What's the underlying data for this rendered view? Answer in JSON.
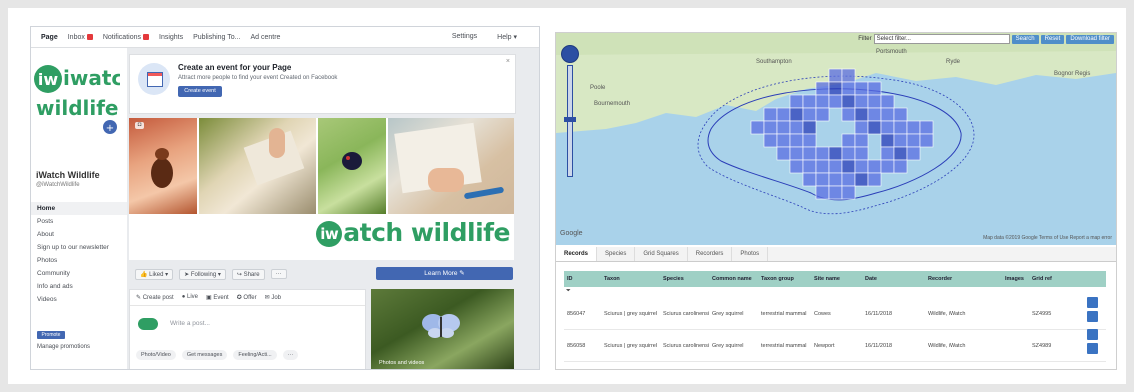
{
  "facebook": {
    "top_tabs": [
      {
        "label": "Page",
        "badge": false,
        "active": true
      },
      {
        "label": "Inbox",
        "badge": true,
        "active": false
      },
      {
        "label": "Notifications",
        "badge": true,
        "active": false
      },
      {
        "label": "Insights",
        "badge": false,
        "active": false
      },
      {
        "label": "Publishing To...",
        "badge": false,
        "active": false
      },
      {
        "label": "Ad centre",
        "badge": false,
        "active": false
      }
    ],
    "settings_label": "Settings",
    "help_label": "Help ▾",
    "logo_top": "iwatch",
    "logo_bottom": "wildlife",
    "page_name": "iWatch Wildlife",
    "page_handle": "@iWatchWildlife",
    "nav": [
      "Home",
      "Posts",
      "About",
      "Sign up to our newsletter",
      "Photos",
      "Community",
      "Info and ads",
      "Videos"
    ],
    "promote_label": "Promote",
    "manage_label": "Manage promotions",
    "event_card": {
      "title": "Create an event for your Page",
      "subtitle": "Attract more people to find your event Created on Facebook",
      "button": "Create event",
      "close": "×"
    },
    "cover_logo_circle": "iw",
    "cover_logo_text": "atch wildlife",
    "actions": [
      "👍 Liked ▾",
      "➤ Following ▾",
      "↪ Share",
      "···"
    ],
    "learn_more": "Learn More ✎",
    "composer_tabs": [
      "✎ Create post",
      "● Live",
      "▣ Event",
      "✪ Offer",
      "✉ Job"
    ],
    "composer_placeholder": "Write a post...",
    "composer_buttons": [
      "Photo/Video",
      "Get messages",
      "Feeling/Acti...",
      "···"
    ],
    "side_caption": "Photos and videos"
  },
  "map_app": {
    "filter_label": "Filter",
    "filter_value": "Select filter...",
    "toolbar_buttons": [
      "Search",
      "Reset",
      "Download filter"
    ],
    "map_places": [
      "Portsmouth",
      "Southampton",
      "Bournemouth",
      "Poole",
      "Ryde",
      "Bognor Regis"
    ],
    "google_label": "Google",
    "map_footer": "Map data ©2019 Google   Terms of Use   Report a map error",
    "tabs": [
      "Records",
      "Species",
      "Grid Squares",
      "Recorders",
      "Photos"
    ],
    "active_tab": "Records",
    "columns": [
      "ID",
      "Taxon",
      "Species",
      "Common name",
      "Taxon group",
      "Site name",
      "Date",
      "Recorder",
      "Images",
      "Grid ref"
    ],
    "filter_glyph": "⏷",
    "rows": [
      {
        "id": "856047",
        "taxon": "Sciurus | grey squirrel",
        "species": "Sciurus carolinensis",
        "common": "Grey squirrel",
        "group": "terrestrial mammal",
        "site": "Cowes",
        "date": "16/11/2018",
        "recorder": "Wildlife, iWatch",
        "images": "",
        "gridref": "SZ4995"
      },
      {
        "id": "856058",
        "taxon": "Sciurus | grey squirrel",
        "species": "Sciurus carolinensis",
        "common": "Grey squirrel",
        "group": "terrestrial mammal",
        "site": "Newport",
        "date": "16/11/2018",
        "recorder": "Wildlife, iWatch",
        "images": "",
        "gridref": "SZ4989"
      }
    ],
    "colors": {
      "grid_fill": "#5b6ee1",
      "grid_dark": "#2b3eb8",
      "sea": "#a9d2ea",
      "land": "#d8e8c4",
      "header": "#9fd0c5"
    }
  }
}
